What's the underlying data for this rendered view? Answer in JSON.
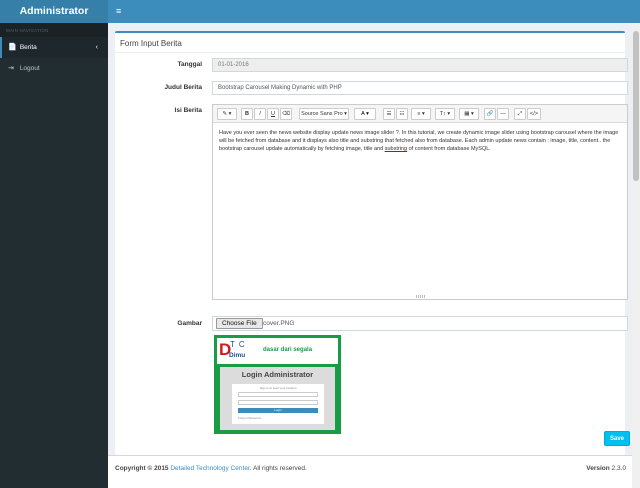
{
  "header": {
    "logo": "Administrator",
    "toggle_icon": "≡"
  },
  "sidebar": {
    "nav_header": "MAIN NAVIGATION",
    "items": [
      {
        "label": "Berita",
        "icon": "📄",
        "chevron": "‹"
      },
      {
        "label": "Logout",
        "icon": "⇥"
      }
    ]
  },
  "form": {
    "title": "Form Input Berita",
    "tanggal_label": "Tanggal",
    "tanggal_value": "01-01-2016",
    "judul_label": "Judul Berita",
    "judul_value": "Bootstrap Carousel Making Dynamic with PHP",
    "isi_label": "Isi Berita",
    "toolbar": {
      "magic": "✎ ▾",
      "bold": "B",
      "italic": "I",
      "underline": "U",
      "eraser": "⌫",
      "font": "Source Sans Pro ▾",
      "color": "A ▾",
      "ul": "☰",
      "ol": "☷",
      "align": "≡ ▾",
      "height": "T↕ ▾",
      "table": "▦ ▾",
      "link": "🔗",
      "hr": "—",
      "fullscreen": "⤢",
      "code": "</>"
    },
    "content_before": "Have you ever seen the news website display update news image slider ?. In this tutorial, we create dynamic image slider using bootstrap carousel where the image will be fetched from database and it displays also title and substring that fetched also from database. Each admin update news contain : image, title, content.. the bootstrap carousel update automatically by fetching image, title and ",
    "content_err": "substring",
    "content_after": " of content from database MySQL.",
    "gambar_label": "Gambar",
    "file_button": "Choose File",
    "file_name": "cover.PNG",
    "preview": {
      "d": "D",
      "tc": "TC",
      "dimu": "Dimu",
      "tag": "dasar dari segala",
      "panel_title": "Login Administrator",
      "card_sub": "Sign in to start your session",
      "button": "Login",
      "forgot": "Forgot Password"
    },
    "save_label": "Save"
  },
  "footer": {
    "copyright_prefix": "Copyright © 2015 ",
    "company": "Detailed Technology Center",
    "copyright_suffix": ". All rights reserved.",
    "version_label": "Version",
    "version_value": " 2.3.0"
  },
  "colors": {
    "primary": "#3c8dbc",
    "logo_bg": "#367fa9",
    "sidebar_bg": "#222d32",
    "save": "#00c0ef"
  }
}
